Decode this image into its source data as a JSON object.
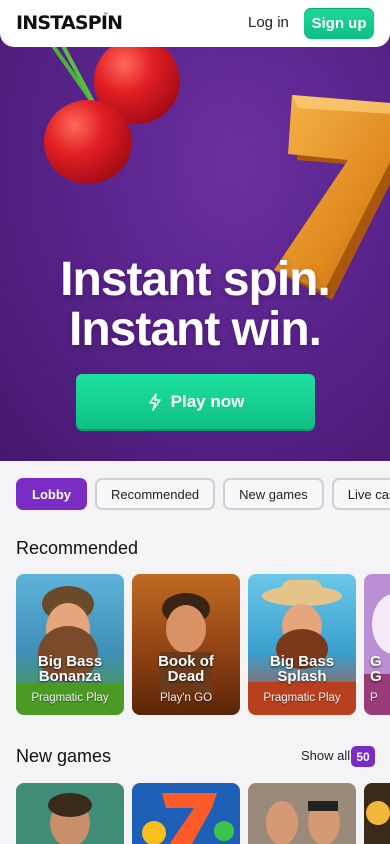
{
  "header": {
    "logo": "INSTASPIN",
    "logo_mark": "™",
    "login_label": "Log in",
    "signup_label": "Sign up"
  },
  "hero": {
    "headline_line1": "Instant spin.",
    "headline_line2": "Instant win.",
    "play_label": "Play now"
  },
  "tabs": [
    {
      "label": "Lobby",
      "active": true
    },
    {
      "label": "Recommended"
    },
    {
      "label": "New games"
    },
    {
      "label": "Live casino"
    }
  ],
  "recommended": {
    "title": "Recommended",
    "games": [
      {
        "name_line1": "Big Bass",
        "name_line2": "Bonanza",
        "provider": "Pragmatic Play"
      },
      {
        "name_line1": "Book of",
        "name_line2": "Dead",
        "provider": "Play'n GO"
      },
      {
        "name_line1": "Big Bass",
        "name_line2": "Splash",
        "provider": "Pragmatic Play"
      },
      {
        "name_line1": "G",
        "name_line2": "G",
        "provider": "P"
      }
    ]
  },
  "new_games": {
    "title": "New games",
    "show_all_label": "Show all",
    "count": "50"
  },
  "colors": {
    "brand_purple": "#7a2cc4",
    "brand_green": "#13c98c",
    "hero_bg": "#5a248c"
  }
}
